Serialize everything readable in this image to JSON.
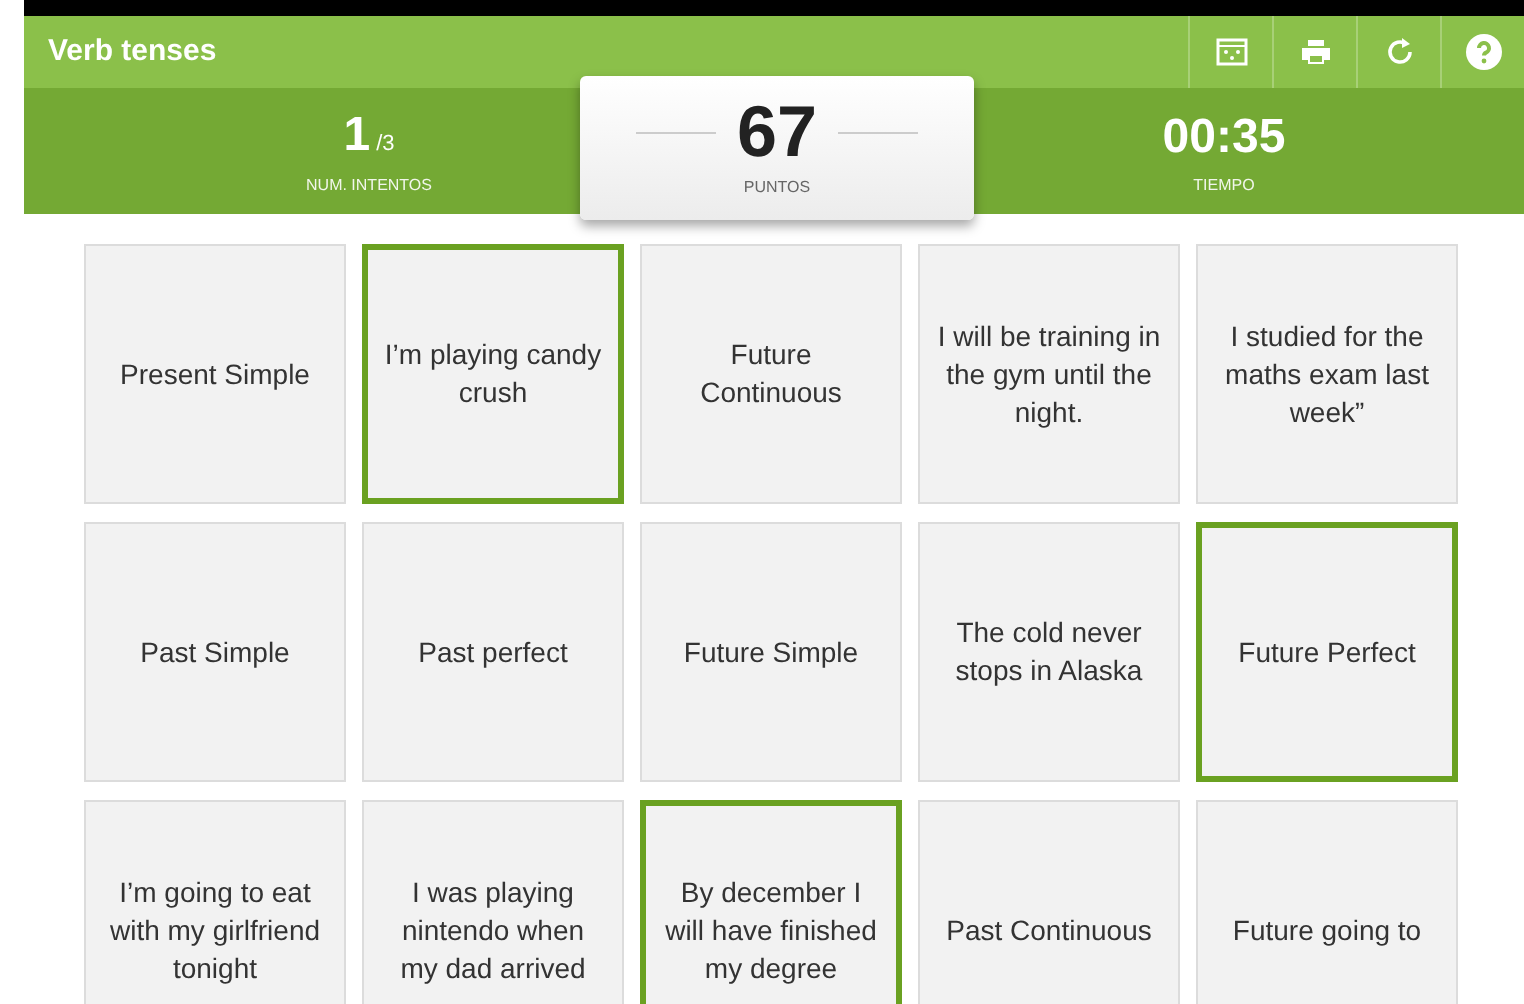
{
  "header": {
    "title": "Verb tenses",
    "tools": [
      {
        "kind": "gallery"
      },
      {
        "kind": "print"
      },
      {
        "kind": "restart"
      },
      {
        "kind": "help"
      }
    ]
  },
  "stats": {
    "attempts": {
      "value": "1",
      "total": "/3",
      "label": "NUM. INTENTOS"
    },
    "score": {
      "value": "67",
      "label": "PUNTOS"
    },
    "time": {
      "value": "00:35",
      "label": "TIEMPO"
    }
  },
  "cards": [
    {
      "text": "Present Simple",
      "selected": false
    },
    {
      "text": "I’m playing candy crush",
      "selected": true
    },
    {
      "text": "Future Continuous",
      "selected": false
    },
    {
      "text": "I will be training in the gym until the night.",
      "selected": false
    },
    {
      "text": "I studied for the maths exam last week”",
      "selected": false
    },
    {
      "text": "Past Simple",
      "selected": false
    },
    {
      "text": "Past perfect",
      "selected": false
    },
    {
      "text": "Future Simple",
      "selected": false
    },
    {
      "text": "The cold never stops in Alaska",
      "selected": false
    },
    {
      "text": "Future Perfect",
      "selected": true
    },
    {
      "text": "I’m going to eat with my girlfriend tonight",
      "selected": false
    },
    {
      "text": "I was playing nintendo when my dad arrived",
      "selected": false
    },
    {
      "text": "By december I will have finished my degree",
      "selected": true
    },
    {
      "text": "Past Continuous",
      "selected": false
    },
    {
      "text": "Future going to",
      "selected": false
    }
  ]
}
